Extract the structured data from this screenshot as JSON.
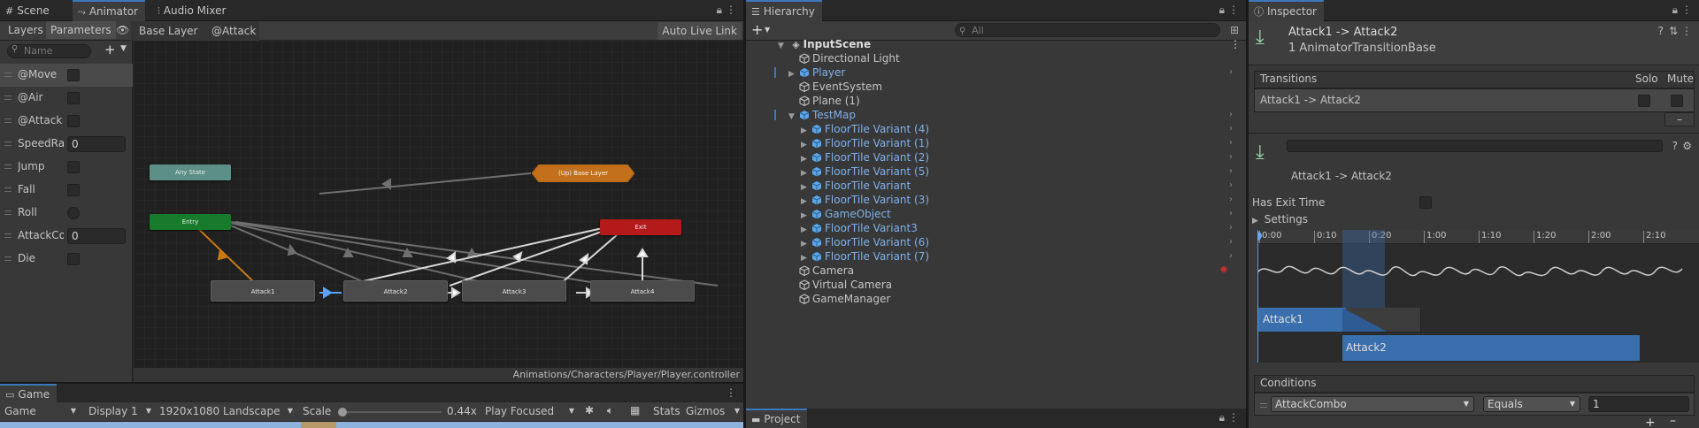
{
  "animator": {
    "tabs": [
      "Scene",
      "Animator",
      "Audio Mixer"
    ],
    "sub_tabs": [
      "Layers",
      "Parameters"
    ],
    "breadcrumb": [
      "Base Layer",
      "@Attack"
    ],
    "auto_live_link": "Auto Live Link",
    "search_placeholder": "Name",
    "parameters": [
      {
        "name": "@Move",
        "type": "bool"
      },
      {
        "name": "@Air",
        "type": "bool"
      },
      {
        "name": "@Attack",
        "type": "bool"
      },
      {
        "name": "SpeedRa",
        "type": "float",
        "value": "0"
      },
      {
        "name": "Jump",
        "type": "bool"
      },
      {
        "name": "Fall",
        "type": "bool"
      },
      {
        "name": "Roll",
        "type": "trigger"
      },
      {
        "name": "AttackCo",
        "type": "int",
        "value": "0"
      },
      {
        "name": "Die",
        "type": "bool"
      }
    ],
    "nodes": {
      "any_state": "Any State",
      "up_base": "(Up) Base Layer",
      "entry": "Entry",
      "exit": "Exit",
      "attack1": "Attack1",
      "attack2": "Attack2",
      "attack3": "Attack3",
      "attack4": "Attack4"
    },
    "footer_path": "Animations/Characters/Player/Player.controller"
  },
  "game": {
    "tab": "Game",
    "mode": "Game",
    "display": "Display 1",
    "resolution": "1920x1080 Landscape",
    "scale_label": "Scale",
    "scale_value": "0.44x",
    "play_mode": "Play Focused",
    "stats": "Stats",
    "gizmos": "Gizmos"
  },
  "hierarchy": {
    "tab": "Hierarchy",
    "search_placeholder": "All",
    "scene": "InputScene",
    "items": [
      {
        "label": "Directional Light",
        "prefab": false,
        "expand": false,
        "indent": 1
      },
      {
        "label": "Player",
        "prefab": true,
        "expand": true,
        "indent": 1
      },
      {
        "label": "EventSystem",
        "prefab": false,
        "expand": false,
        "indent": 1
      },
      {
        "label": "Plane (1)",
        "prefab": false,
        "expand": false,
        "indent": 1
      },
      {
        "label": "TestMap",
        "prefab": true,
        "expand": true,
        "expanded": true,
        "indent": 1
      },
      {
        "label": "FloorTile Variant (4)",
        "prefab": true,
        "expand": true,
        "indent": 2
      },
      {
        "label": "FloorTile Variant (1)",
        "prefab": true,
        "expand": true,
        "indent": 2
      },
      {
        "label": "FloorTile Variant (2)",
        "prefab": true,
        "expand": true,
        "indent": 2
      },
      {
        "label": "FloorTile Variant (5)",
        "prefab": true,
        "expand": true,
        "indent": 2
      },
      {
        "label": "FloorTile Variant",
        "prefab": true,
        "expand": true,
        "indent": 2
      },
      {
        "label": "FloorTile Variant (3)",
        "prefab": true,
        "expand": true,
        "indent": 2
      },
      {
        "label": "GameObject",
        "prefab": true,
        "expand": true,
        "indent": 2
      },
      {
        "label": "FloorTile Variant3",
        "prefab": true,
        "expand": true,
        "indent": 2
      },
      {
        "label": "FloorTile Variant (6)",
        "prefab": true,
        "expand": true,
        "indent": 2
      },
      {
        "label": "FloorTile Variant (7)",
        "prefab": true,
        "expand": true,
        "indent": 2
      },
      {
        "label": "Camera",
        "prefab": false,
        "expand": false,
        "indent": 1
      },
      {
        "label": "Virtual Camera",
        "prefab": false,
        "expand": false,
        "indent": 1
      },
      {
        "label": "GameManager",
        "prefab": false,
        "expand": false,
        "indent": 1
      }
    ]
  },
  "project": {
    "tab": "Project"
  },
  "inspector": {
    "tab": "Inspector",
    "title": "Attack1 -> Attack2",
    "subtitle": "1 AnimatorTransitionBase",
    "transitions_header": "Transitions",
    "solo": "Solo",
    "mute": "Mute",
    "transition_row": "Attack1 -> Attack2",
    "transition_name": "Attack1 -> Attack2",
    "has_exit_time": "Has Exit Time",
    "settings": "Settings",
    "timeline_ticks": [
      "0:00",
      "0:10",
      "0:20",
      "1:00",
      "1:10",
      "1:20",
      "2:00",
      "2:10"
    ],
    "clip1": "Attack1",
    "clip2": "Attack2",
    "conditions_header": "Conditions",
    "condition": {
      "param": "AttackCombo",
      "op": "Equals",
      "value": "1"
    }
  }
}
